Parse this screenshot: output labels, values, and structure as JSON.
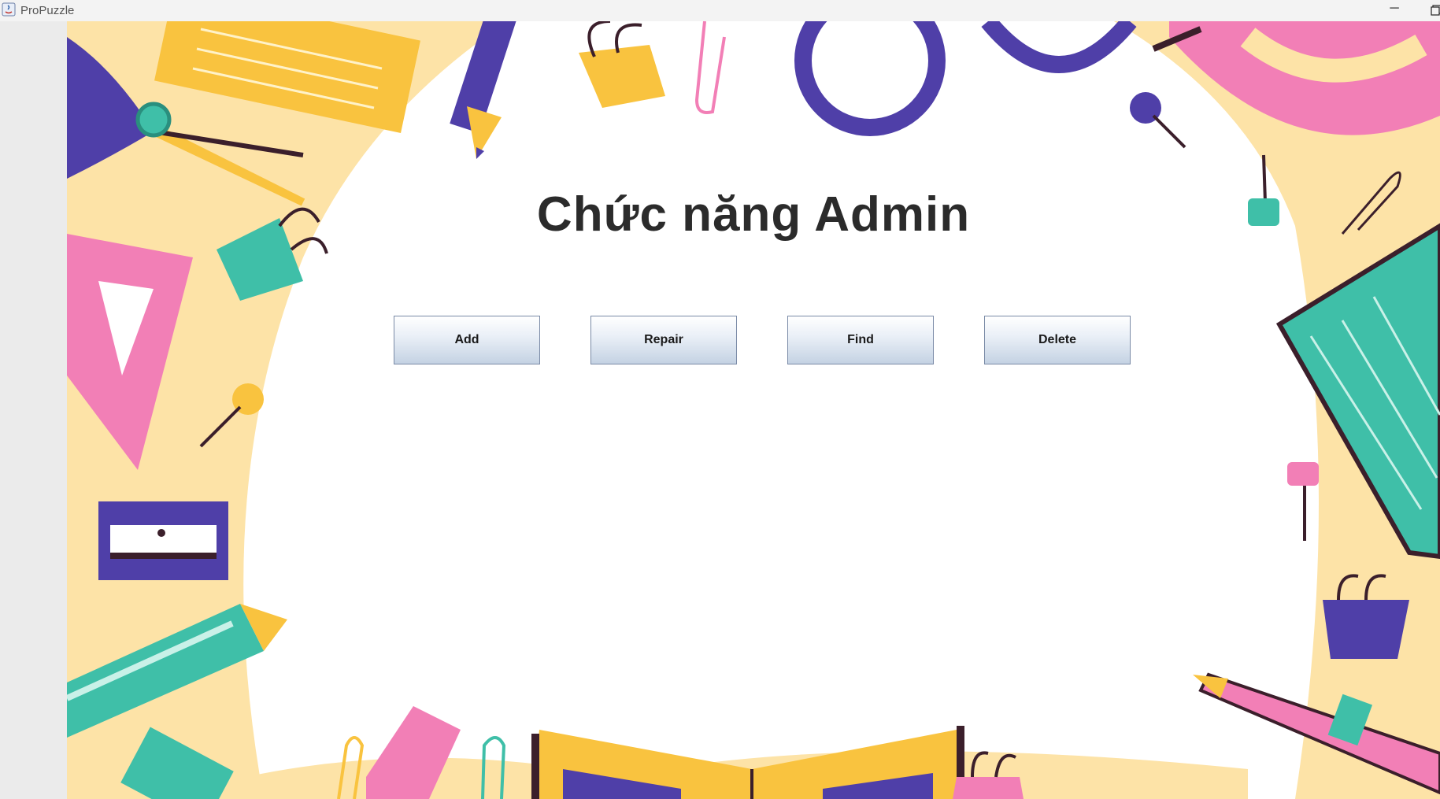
{
  "window": {
    "title": "ProPuzzle",
    "minimize_glyph": "─"
  },
  "main": {
    "heading": "Chức năng Admin",
    "buttons": [
      {
        "label": "Add"
      },
      {
        "label": "Repair"
      },
      {
        "label": "Find"
      },
      {
        "label": "Delete"
      }
    ]
  },
  "theme": {
    "yellow": "#f9c33f",
    "purple": "#4f3fa8",
    "pink": "#f27fb6",
    "teal": "#3fbfa8",
    "cream": "#fde3a7",
    "dark": "#3b1f2b"
  },
  "decorations": [
    "scissors-icon",
    "note-paper-icon",
    "pencil-icon",
    "binder-clip-icon",
    "paperclip-icon",
    "ring-icon",
    "pushpin-icon",
    "protractor-icon",
    "set-square-icon",
    "sharpener-icon",
    "marker-icon",
    "notebook-icon",
    "ruler-icon",
    "open-book-icon"
  ]
}
